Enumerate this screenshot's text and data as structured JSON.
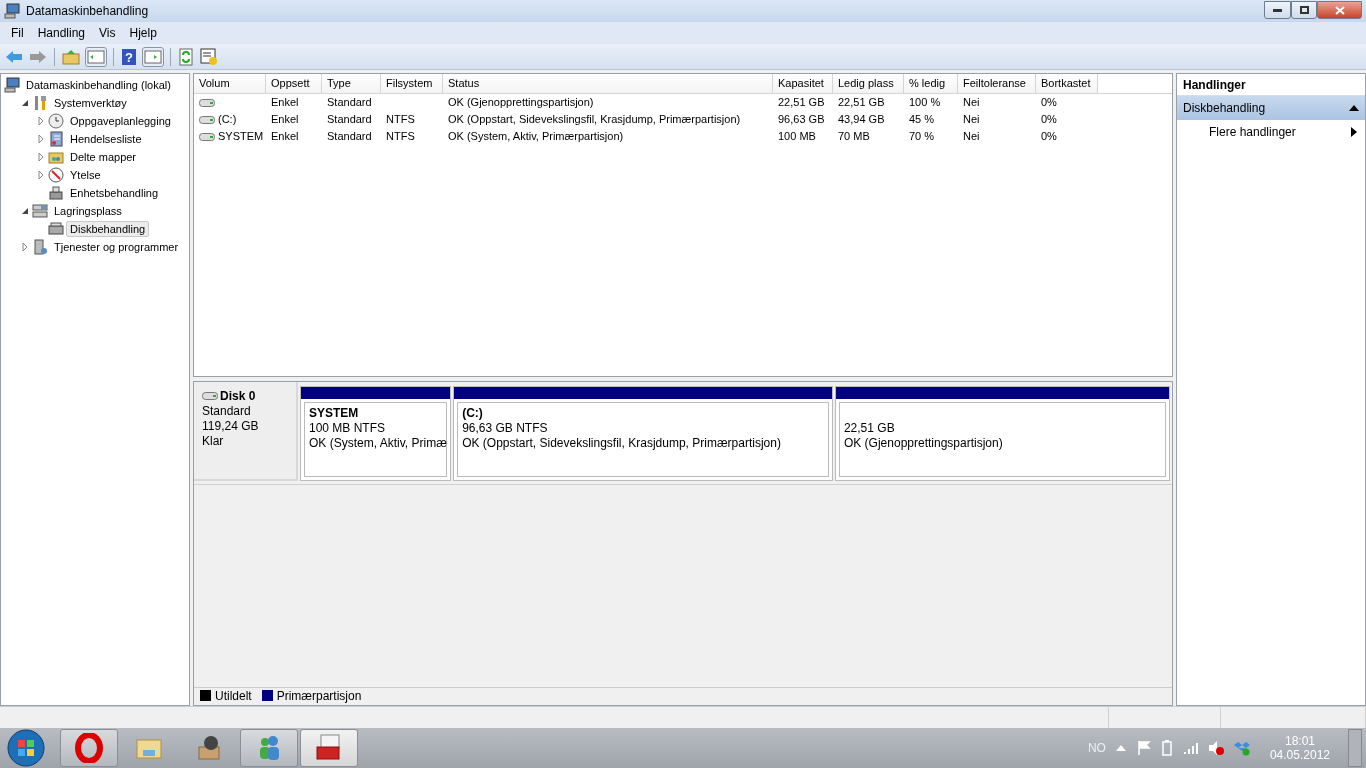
{
  "window": {
    "title": "Datamaskinbehandling"
  },
  "menu": [
    "Fil",
    "Handling",
    "Vis",
    "Hjelp"
  ],
  "toolbar": {
    "help_glyph": "?"
  },
  "tree": [
    {
      "label": "Datamaskinbehandling (lokal)",
      "selected": false,
      "children": [
        {
          "label": "Systemverktøy",
          "expanded": true,
          "selected": false,
          "children": [
            {
              "label": "Oppgaveplanlegging",
              "expanded": false,
              "selected": false
            },
            {
              "label": "Hendelsesliste",
              "expanded": false,
              "selected": false
            },
            {
              "label": "Delte mapper",
              "expanded": false,
              "selected": false
            },
            {
              "label": "Ytelse",
              "expanded": false,
              "selected": false
            },
            {
              "label": "Enhetsbehandling",
              "selected": false
            }
          ]
        },
        {
          "label": "Lagringsplass",
          "expanded": true,
          "selected": false,
          "children": [
            {
              "label": "Diskbehandling",
              "selected": true
            }
          ]
        },
        {
          "label": "Tjenester og programmer",
          "expanded": false,
          "selected": false
        }
      ]
    }
  ],
  "table": {
    "columns": [
      "Volum",
      "Oppsett",
      "Type",
      "Filsystem",
      "Status",
      "Kapasitet",
      "Ledig plass",
      "% ledig",
      "Feiltoleranse",
      "Bortkastet"
    ],
    "rows": [
      [
        "",
        "Enkel",
        "Standard",
        "",
        "OK (Gjenopprettingspartisjon)",
        "22,51 GB",
        "22,51 GB",
        "100 %",
        "Nei",
        "0%"
      ],
      [
        "(C:)",
        "Enkel",
        "Standard",
        "NTFS",
        "OK (Oppstart, Sidevekslingsfil, Krasjdump, Primærpartisjon)",
        "96,63 GB",
        "43,94 GB",
        "45 %",
        "Nei",
        "0%"
      ],
      [
        "SYSTEM",
        "Enkel",
        "Standard",
        "NTFS",
        "OK (System, Aktiv, Primærpartisjon)",
        "100 MB",
        "70 MB",
        "70 %",
        "Nei",
        "0%"
      ]
    ]
  },
  "disk": {
    "name": "Disk 0",
    "type": "Standard",
    "size": "119,24 GB",
    "status": "Klar",
    "partitions": [
      {
        "title": "SYSTEM",
        "size": "100 MB NTFS",
        "status": "OK (System, Aktiv, Primæ",
        "color": "#000080"
      },
      {
        "title": "(C:)",
        "size": "96,63 GB NTFS",
        "status": "OK (Oppstart, Sidevekslingsfil, Krasjdump, Primærpartisjon)",
        "color": "#000080"
      },
      {
        "size": "22,51 GB",
        "status": "OK (Gjenopprettingspartisjon)",
        "color": "#000080"
      }
    ]
  },
  "legend": [
    {
      "label": "Utildelt",
      "color": "#000000"
    },
    {
      "label": "Primærpartisjon",
      "color": "#000080"
    }
  ],
  "actions": {
    "title": "Handlinger",
    "section": {
      "label": "Diskbehandling",
      "expanded": true
    },
    "items": [
      "Flere handlinger"
    ]
  },
  "taskbar": {
    "apps": [
      {
        "open": true,
        "selected": false
      },
      {
        "open": false,
        "selected": false
      },
      {
        "open": false,
        "selected": false
      },
      {
        "open": true,
        "selected": false
      },
      {
        "open": true,
        "selected": true
      }
    ],
    "language": "NO",
    "time": "18:01",
    "date": "04.05.2012"
  }
}
